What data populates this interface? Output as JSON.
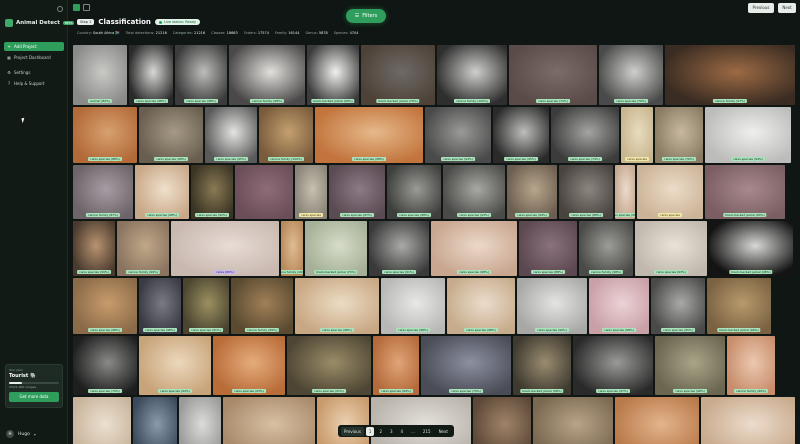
{
  "app": {
    "name": "Animal Detect",
    "badge": "BETA"
  },
  "sidebar": {
    "items": [
      {
        "label": "Add Project",
        "icon": "plus-icon",
        "active": true
      },
      {
        "label": "Project Dashboard",
        "icon": "dashboard-icon",
        "active": false
      },
      {
        "label": "Settings",
        "icon": "gear-icon",
        "active": false
      },
      {
        "label": "Help & Support",
        "icon": "help-icon",
        "active": false
      }
    ],
    "plan": {
      "label": "Your plan",
      "name": "Tourist 🐘",
      "usage": "250/1,000 images",
      "usage_fraction": 0.25,
      "cta": "Get more data"
    },
    "user": {
      "initial": "H",
      "name": "Hugo"
    }
  },
  "header": {
    "filters_label": "Filters",
    "previous_label": "Previous",
    "next_label": "Next",
    "step": "Step 1",
    "title": "Classification",
    "live_status": "Live status: Ready",
    "stats": [
      {
        "label": "Country:",
        "value": "South Africa 🇿🇦"
      },
      {
        "label": "Total detections:",
        "value": "21216"
      },
      {
        "label": "Categories:",
        "value": "21216"
      },
      {
        "label": "Classes:",
        "value": "18663"
      },
      {
        "label": "Orders:",
        "value": "17574"
      },
      {
        "label": "Family:",
        "value": "16144"
      },
      {
        "label": "Genus:",
        "value": "5878"
      },
      {
        "label": "Species:",
        "value": "4704"
      }
    ]
  },
  "tiles": [
    {
      "label": "animal (82%)",
      "style": "green",
      "c1": "#8a8a88",
      "c2": "#c9c9c6"
    },
    {
      "label": "canis species (98%)",
      "style": "green",
      "c1": "#2a2a2a",
      "c2": "#d8d8d6"
    },
    {
      "label": "canis species (98%)",
      "style": "green",
      "c1": "#3b3b3b",
      "c2": "#bdbdbb"
    },
    {
      "label": "canine family (98%)",
      "style": "green",
      "c1": "#4a4848",
      "c2": "#e2e0dc"
    },
    {
      "label": "black-backed jackal (99%)",
      "style": "green",
      "c1": "#3c3c3c",
      "c2": "#f0f0ee"
    },
    {
      "label": "black-backed jackal (70%)",
      "style": "green",
      "c1": "#4e4238",
      "c2": "#6e6a66"
    },
    {
      "label": "canine family (100%)",
      "style": "green",
      "c1": "#2e2e2e",
      "c2": "#cfcfcd"
    },
    {
      "label": "canis species (74%)",
      "style": "green",
      "c1": "#5a4a48",
      "c2": "#7c6c68"
    },
    {
      "label": "canis species (79%)",
      "style": "green",
      "c1": "#4a4a4a",
      "c2": "#cfcfcc"
    },
    {
      "label": "canine family (97%)",
      "style": "green",
      "c1": "#3a2c22",
      "c2": "#9c6a44"
    },
    {
      "label": "canis species (88%)",
      "style": "green",
      "c1": "#b26a38",
      "c2": "#d8a070"
    },
    {
      "label": "canis species (98%)",
      "style": "green",
      "c1": "#6a5e50",
      "c2": "#a69a86"
    },
    {
      "label": "canis species (95%)",
      "style": "green",
      "c1": "#5a5a5a",
      "c2": "#e4e4e2"
    },
    {
      "label": "canine family (100%)",
      "style": "green",
      "c1": "#7a5c3c",
      "c2": "#c4a070"
    },
    {
      "label": "canis species (98%)",
      "style": "green",
      "c1": "#c2743c",
      "c2": "#e6b88a"
    },
    {
      "label": "canis species (94%)",
      "style": "green",
      "c1": "#4a4a4a",
      "c2": "#9a9a98"
    },
    {
      "label": "canis species (95%)",
      "style": "green",
      "c1": "#2a2a2a",
      "c2": "#bebebc"
    },
    {
      "label": "canis species (74%)",
      "style": "green",
      "c1": "#3c3c3c",
      "c2": "#a4a4a2"
    },
    {
      "label": "canis species",
      "style": "yellow",
      "c1": "#c8b68e",
      "c2": "#e8dcc0"
    },
    {
      "label": "canis species (76%)",
      "style": "green",
      "c1": "#8a7c64",
      "c2": "#c8b8a0"
    },
    {
      "label": "canis species (94%)",
      "style": "green",
      "c1": "#bcbcba",
      "c2": "#efefed"
    },
    {
      "label": "canine family (87%)",
      "style": "green",
      "c1": "#6c6468",
      "c2": "#a89ca4"
    },
    {
      "label": "canis species (98%)",
      "style": "green",
      "c1": "#c9a888",
      "c2": "#efe0cc"
    },
    {
      "label": "canis species (92%)",
      "style": "green",
      "c1": "#3a3424",
      "c2": "#8a7a54"
    },
    {
      "label": "",
      "style": "green",
      "c1": "#6a4e58",
      "c2": "#8e6c78"
    },
    {
      "label": "canis species",
      "style": "yellow",
      "c1": "#8a8478",
      "c2": "#c8c0b0"
    },
    {
      "label": "canis species (97%)",
      "style": "green",
      "c1": "#5a4a52",
      "c2": "#8c7a84"
    },
    {
      "label": "canis species (98%)",
      "style": "green",
      "c1": "#3e3e3c",
      "c2": "#9a9a96"
    },
    {
      "label": "canis species (93%)",
      "style": "green",
      "c1": "#4a4a48",
      "c2": "#a8a8a4"
    },
    {
      "label": "canis species (99%)",
      "style": "green",
      "c1": "#6c5e50",
      "c2": "#b8a68c"
    },
    {
      "label": "canis species (88%)",
      "style": "green",
      "c1": "#4a4440",
      "c2": "#8c8680"
    },
    {
      "label": "canis species (98%)",
      "style": "green",
      "c1": "#c6a890",
      "c2": "#ecdccc"
    },
    {
      "label": "canis species",
      "style": "yellow",
      "c1": "#ccb498",
      "c2": "#ecdcc8"
    },
    {
      "label": "black-backed jackal (94%)",
      "style": "green",
      "c1": "#7a5e62",
      "c2": "#a88a8e"
    },
    {
      "label": "canis species (99%)",
      "style": "green",
      "c1": "#4a3a2e",
      "c2": "#b89470"
    },
    {
      "label": "canine family (99%)",
      "style": "green",
      "c1": "#8a7460",
      "c2": "#c0a888"
    },
    {
      "label": "canis (95%)",
      "style": "purple",
      "c1": "#c8b8b0",
      "c2": "#e8dcd4"
    },
    {
      "label": "canine family (100%)",
      "style": "green",
      "c1": "#b88a5c",
      "c2": "#e0bc94"
    },
    {
      "label": "black-backed jackal (74%)",
      "style": "green",
      "c1": "#a6b098",
      "c2": "#d6dcc8"
    },
    {
      "label": "canis species (91%)",
      "style": "green",
      "c1": "#3a3a3a",
      "c2": "#aaaaa8"
    },
    {
      "label": "canis species (98%)",
      "style": "green",
      "c1": "#c8a690",
      "c2": "#ecd8c8"
    },
    {
      "label": "canis species (88%)",
      "style": "green",
      "c1": "#5c4850",
      "c2": "#8a727c"
    },
    {
      "label": "canine family (98%)",
      "style": "green",
      "c1": "#4a4a48",
      "c2": "#9c9c98"
    },
    {
      "label": "canis species (93%)",
      "style": "green",
      "c1": "#c0b8ac",
      "c2": "#e8e2d8"
    },
    {
      "label": "black-backed jackal (98%)",
      "style": "green",
      "c1": "#141414",
      "c2": "#d8d8d6"
    },
    {
      "label": "canis species (98%)",
      "style": "green",
      "c1": "#8a6a48",
      "c2": "#c89c6c"
    },
    {
      "label": "canis species (98%)",
      "style": "green",
      "c1": "#3a3a44",
      "c2": "#7a7a84"
    },
    {
      "label": "canis species (91%)",
      "style": "green",
      "c1": "#4a4430",
      "c2": "#9c9060"
    },
    {
      "label": "canine family (99%)",
      "style": "green",
      "c1": "#5a4a30",
      "c2": "#a08058"
    },
    {
      "label": "canis species (98%)",
      "style": "green",
      "c1": "#c8a884",
      "c2": "#ecdcc4"
    },
    {
      "label": "canis species (98%)",
      "style": "green",
      "c1": "#b8b8b6",
      "c2": "#e8e8e6"
    },
    {
      "label": "canis species (98%)",
      "style": "green",
      "c1": "#c6ac8c",
      "c2": "#ecdccc"
    },
    {
      "label": "canis species (99%)",
      "style": "green",
      "c1": "#a8a8a6",
      "c2": "#e4e4e2"
    },
    {
      "label": "canis species (98%)",
      "style": "green",
      "c1": "#c8a0a6",
      "c2": "#ecd2d6"
    },
    {
      "label": "canis species (95%)",
      "style": "green",
      "c1": "#4a4a48",
      "c2": "#aaaaa8"
    },
    {
      "label": "black-backed jackal (99%)",
      "style": "green",
      "c1": "#7a6242",
      "c2": "#b89a6c"
    },
    {
      "label": "canis species (79%)",
      "style": "green",
      "c1": "#1e1e1e",
      "c2": "#8a8a88"
    },
    {
      "label": "canis species (94%)",
      "style": "green",
      "c1": "#c8a47a",
      "c2": "#ecd8bc"
    },
    {
      "label": "canis species (93%)",
      "style": "green",
      "c1": "#b86c38",
      "c2": "#e6ac7c"
    },
    {
      "label": "canis species (91%)",
      "style": "green",
      "c1": "#4e4634",
      "c2": "#9a8c68"
    },
    {
      "label": "canis species (99%)",
      "style": "green",
      "c1": "#b46a3a",
      "c2": "#e0a478"
    },
    {
      "label": "canis species (79%)",
      "style": "green",
      "c1": "#4a4c56",
      "c2": "#8c90a0"
    },
    {
      "label": "black-backed jackal (98%)",
      "style": "green",
      "c1": "#3e3a30",
      "c2": "#9a8c70"
    },
    {
      "label": "canis species (97%)",
      "style": "green",
      "c1": "#2a2a2a",
      "c2": "#9a9a98"
    },
    {
      "label": "canis species (96%)",
      "style": "green",
      "c1": "#6a6650",
      "c2": "#aaa488"
    },
    {
      "label": "canine family (99%)",
      "style": "green",
      "c1": "#c88e6c",
      "c2": "#ecc8b0"
    },
    {
      "label": "canis (97%)",
      "style": "green",
      "c1": "#c8b49c",
      "c2": "#ece0d0"
    },
    {
      "label": "",
      "style": "green",
      "c1": "#3a4a5a",
      "c2": "#8a9aaa"
    },
    {
      "label": "",
      "style": "green",
      "c1": "#9a9a98",
      "c2": "#dcdcda"
    },
    {
      "label": "",
      "style": "green",
      "c1": "#a88a6a",
      "c2": "#d8c0a4"
    },
    {
      "label": "",
      "style": "green",
      "c1": "#c89a6c",
      "c2": "#ecd0b0"
    },
    {
      "label": "",
      "style": "green",
      "c1": "#b8b4ac",
      "c2": "#e4e0da"
    },
    {
      "label": "",
      "style": "green",
      "c1": "#5c4838",
      "c2": "#a08468"
    },
    {
      "label": "",
      "style": "green",
      "c1": "#7a6850",
      "c2": "#b8a488"
    },
    {
      "label": "",
      "style": "green",
      "c1": "#b87a4a",
      "c2": "#e4b48c"
    },
    {
      "label": "",
      "style": "green",
      "c1": "#c8aa8c",
      "c2": "#ecdccc"
    },
    {
      "label": "",
      "style": "green",
      "c1": "#aca8a0",
      "c2": "#e0dcd4"
    }
  ],
  "pagination": {
    "previous": "Previous",
    "pages": [
      "1",
      "2",
      "3",
      "4",
      "...",
      "215"
    ],
    "current": "1",
    "next": "Next"
  }
}
